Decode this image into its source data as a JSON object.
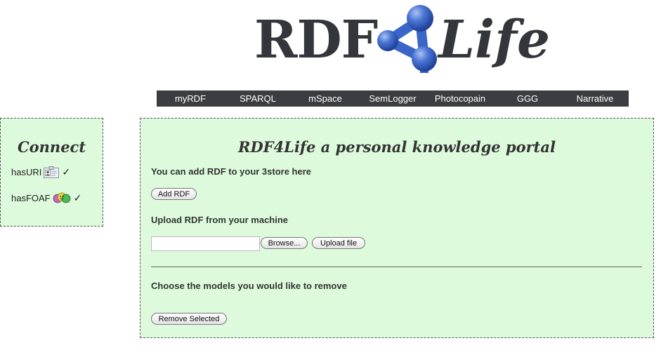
{
  "logo": {
    "part1": "RDF",
    "part2": "Life"
  },
  "nav": {
    "items": [
      "myRDF",
      "SPARQL",
      "mSpace",
      "SemLogger",
      "Photocopain",
      "GGG",
      "Narrative"
    ]
  },
  "sidebar": {
    "title": "Connect",
    "items": [
      {
        "label": "hasURI",
        "icon": "id-card-icon",
        "status": "✓"
      },
      {
        "label": "hasFOAF",
        "icon": "people-icon",
        "status": "✓"
      }
    ]
  },
  "main": {
    "title": "RDF4Life a personal knowledge portal",
    "add_section_label": "You can add RDF to your 3store here",
    "add_button": "Add RDF",
    "upload_label": "Upload RDF from your machine",
    "file_value": "",
    "browse_button": "Browse...",
    "upload_button": "Upload file",
    "remove_label": "Choose the models you would like to remove",
    "remove_button": "Remove Selected"
  },
  "colors": {
    "panel_bg": "#ddfadc",
    "nav_bg": "#3b3d40",
    "logo_blue": "#3a66c8",
    "logo_text": "#34363b"
  }
}
